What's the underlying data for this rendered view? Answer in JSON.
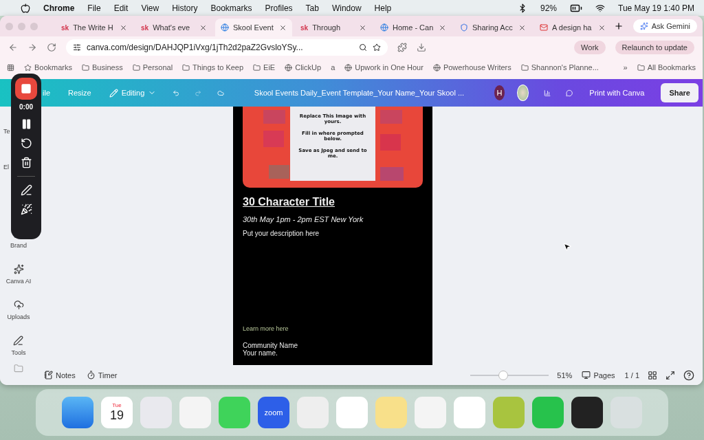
{
  "menubar": {
    "app": "Chrome",
    "menus": [
      "File",
      "Edit",
      "View",
      "History",
      "Bookmarks",
      "Profiles",
      "Tab",
      "Window",
      "Help"
    ],
    "battery": "92%",
    "clock": "Tue May 19  1:40 PM"
  },
  "tabs": [
    {
      "title": "The Write H",
      "favicon": "sk",
      "selected": false
    },
    {
      "title": "What's eve",
      "favicon": "sk",
      "selected": false
    },
    {
      "title": "Skool Event",
      "kind": "canva",
      "selected": true
    },
    {
      "title": "Through",
      "favicon": "sk",
      "selected": false
    },
    {
      "title": "Home - Can",
      "kind": "canva",
      "selected": false
    },
    {
      "title": "Sharing Acc",
      "kind": "app",
      "selected": false
    },
    {
      "title": "A design ha",
      "kind": "mail",
      "selected": false
    }
  ],
  "ask_gemini": "Ask Gemini",
  "address": "canva.com/design/DAHJQP1iVxg/1jTh2d2paZ2GvsloYSy...",
  "profile": "Work",
  "relaunch": "Relaunch to update",
  "bookmarks": [
    {
      "label": "Bookmarks",
      "kind": "star"
    },
    {
      "label": "Business",
      "kind": "folder"
    },
    {
      "label": "Personal",
      "kind": "folder"
    },
    {
      "label": "Things to Keep",
      "kind": "folder"
    },
    {
      "label": "EiE",
      "kind": "folder"
    },
    {
      "label": "ClickUp",
      "kind": "site"
    },
    {
      "label": "a",
      "kind": "text"
    },
    {
      "label": "Upwork in One Hour",
      "kind": "site"
    },
    {
      "label": "Powerhouse Writers",
      "kind": "site"
    },
    {
      "label": "Shannon's Planne...",
      "kind": "folder"
    }
  ],
  "bookmarks_more": "»",
  "all_bookmarks": "All Bookmarks",
  "editor": {
    "file": "ile",
    "resize": "Resize",
    "mode": "Editing",
    "title": "Skool Events Daily_Event Template_Your Name_Your Skool ...",
    "avatar": "H",
    "print": "Print with Canva",
    "share": "Share"
  },
  "sidebar": [
    {
      "label": "Te",
      "kind": "covered"
    },
    {
      "label": "El",
      "kind": "covered"
    },
    {
      "label": "Brand"
    },
    {
      "label": "Canva AI"
    },
    {
      "label": "Uploads"
    },
    {
      "label": "Tools"
    }
  ],
  "recorder": {
    "time": "0:00"
  },
  "design": {
    "note": [
      "Replace  This Image with yours.",
      "Fill in where prompted below.",
      "Save as Jpeg and send to me."
    ],
    "title": "30 Character Title",
    "when": "30th May  1pm  - 2pm  EST New York",
    "description": "Put your description here",
    "link": "Learn more here",
    "community": "Community Name",
    "name": "Your name."
  },
  "footer": {
    "notes": "Notes",
    "timer": "Timer",
    "zoom": {
      "level": 0.42,
      "reading": "51%"
    },
    "pages": "Pages",
    "page_count": "1 / 1"
  },
  "dock": {
    "calendar_day": "Tue",
    "calendar_date": "19",
    "zoom_label": "zoom"
  }
}
